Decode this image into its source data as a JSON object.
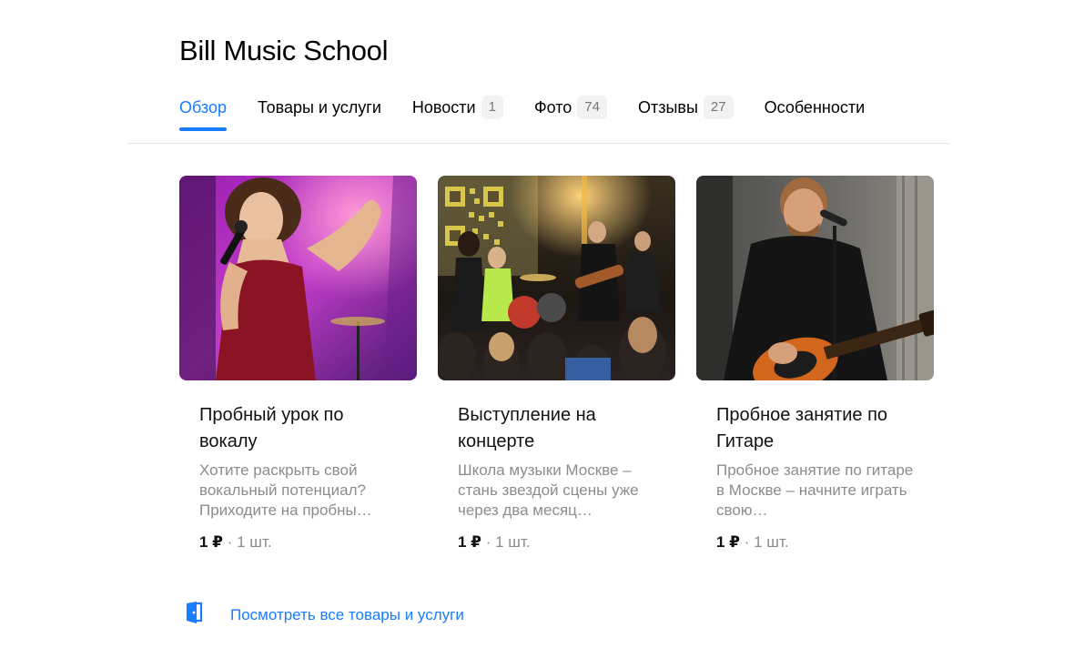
{
  "header": {
    "title": "Bill Music School"
  },
  "tabs": [
    {
      "label": "Обзор",
      "count": ""
    },
    {
      "label": "Товары и услуги",
      "count": ""
    },
    {
      "label": "Новости",
      "count": "1"
    },
    {
      "label": "Фото",
      "count": "74"
    },
    {
      "label": "Отзывы",
      "count": "27"
    },
    {
      "label": "Особенности",
      "count": ""
    }
  ],
  "cards": [
    {
      "title": "Пробный урок по вокалу",
      "desc": "Хотите раскрыть свой вокальный потенциал? Приходите на пробны…",
      "price": "1 ₽",
      "sep": " · ",
      "qty": "1 шт."
    },
    {
      "title": "Выступление на концерте",
      "desc": "Школа музыки Москве – стань звездой сцены уже через два месяц…",
      "price": "1 ₽",
      "sep": " · ",
      "qty": "1 шт."
    },
    {
      "title": "Пробное занятие по Гитаре",
      "desc": "Пробное занятие по гитаре в Москве – начните играть свою…",
      "price": "1 ₽",
      "sep": " · ",
      "qty": "1 шт."
    }
  ],
  "footer": {
    "all_link": "Посмотреть все товары и услуги"
  },
  "colors": {
    "accent": "#1a7cff",
    "badge_bg": "#f2f2f2",
    "muted_text": "#8c8c8c",
    "divider": "#e6e6e6"
  },
  "icons": {
    "all_link_icon": "catalog-door-icon"
  }
}
